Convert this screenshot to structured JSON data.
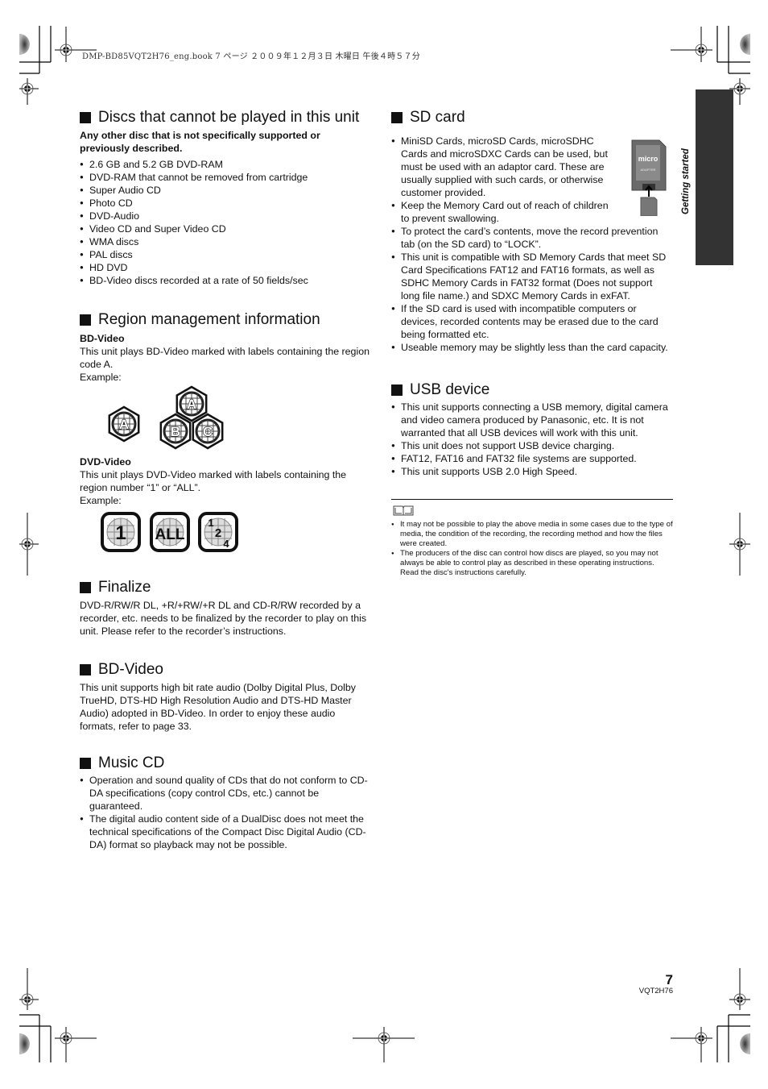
{
  "header": {
    "print_line": "DMP-BD85VQT2H76_eng.book  7 ページ  ２００９年１２月３日  木曜日  午後４時５７分"
  },
  "side_tab": {
    "label": "Getting started",
    "color": "#333333"
  },
  "left": {
    "discs": {
      "title": "Discs that cannot be played in this unit",
      "intro": "Any other disc that is not specifically supported or previously described.",
      "items": [
        "2.6 GB and 5.2 GB DVD-RAM",
        "DVD-RAM that cannot be removed from cartridge",
        "Super Audio CD",
        "Photo CD",
        "DVD-Audio",
        "Video CD and Super Video CD",
        "WMA discs",
        "PAL discs",
        "HD DVD",
        "BD-Video discs recorded at a rate of 50 fields/sec"
      ]
    },
    "region": {
      "title": "Region management information",
      "bd_label": "BD-Video",
      "bd_text": "This unit plays BD-Video marked with labels containing the region code A.",
      "bd_example": "Example:",
      "bd_logos": [
        [
          "A"
        ],
        [
          "A",
          "B",
          "C"
        ]
      ],
      "dvd_label": "DVD-Video",
      "dvd_text": "This unit plays DVD-Video marked with labels containing the region number “1” or “ALL”.",
      "dvd_example": "Example:",
      "dvd_logos": [
        {
          "main": "1"
        },
        {
          "main": "ALL"
        },
        {
          "top": "1",
          "mid": "2",
          "bot": "4"
        }
      ]
    },
    "finalize": {
      "title": "Finalize",
      "text": "DVD-R/RW/R DL, +R/+RW/+R DL and CD-R/RW recorded by a recorder, etc. needs to be finalized by the recorder to play on this unit. Please refer to the recorder’s instructions."
    },
    "bdvideo": {
      "title": "BD-Video",
      "text": "This unit supports high bit rate audio (Dolby Digital Plus, Dolby TrueHD, DTS-HD High Resolution Audio and DTS-HD Master Audio) adopted in BD-Video. In order to enjoy these audio formats, refer to page 33."
    },
    "musiccd": {
      "title": "Music CD",
      "items": [
        "Operation and sound quality of CDs that do not conform to CD-DA specifications (copy control CDs, etc.) cannot be guaranteed.",
        "The digital audio content side of a DualDisc does not meet the technical specifications of the Compact Disc Digital Audio (CD-DA) format so playback may not be possible."
      ]
    }
  },
  "right": {
    "sdcard": {
      "title": "SD card",
      "items": [
        "MiniSD Cards, microSD Cards, microSDHC Cards and microSDXC Cards can be used, but must be used with an adaptor card. These are usually supplied with such cards, or otherwise customer provided.",
        "Keep the Memory Card out of reach of children to prevent swallowing.",
        "To protect the card’s contents, move the record prevention tab (on the SD card) to “LOCK”.",
        "This unit is compatible with SD Memory Cards that meet SD Card Specifications FAT12 and FAT16 formats, as well as SDHC Memory Cards in FAT32 format (Does not support long file name.) and SDXC Memory Cards in exFAT.",
        "If the SD card is used with incompatible computers or devices, recorded contents may be erased due to the card being formatted etc.",
        "Useable memory may be slightly less than the card capacity."
      ],
      "image_brand": "micro SD",
      "image_adapter": "ADAPTER"
    },
    "usb": {
      "title": "USB device",
      "items": [
        "This unit supports connecting a USB memory, digital camera and video camera produced by Panasonic, etc. It is not warranted that all USB devices will work with this unit.",
        "This unit does not support USB device charging.",
        "FAT12, FAT16 and FAT32 file systems are supported.",
        "This unit supports USB 2.0 High Speed."
      ]
    },
    "notes": {
      "icon": "book-icon",
      "items": [
        "It may not be possible to play the above media in some cases due to the type of media, the condition of the recording, the recording method and how the files were created.",
        "The producers of the disc can control how discs are played, so you may not always be able to control play as described in these operating instructions. Read the disc's instructions carefully."
      ]
    }
  },
  "footer": {
    "page_number": "7",
    "doc_code": "VQT2H76"
  }
}
